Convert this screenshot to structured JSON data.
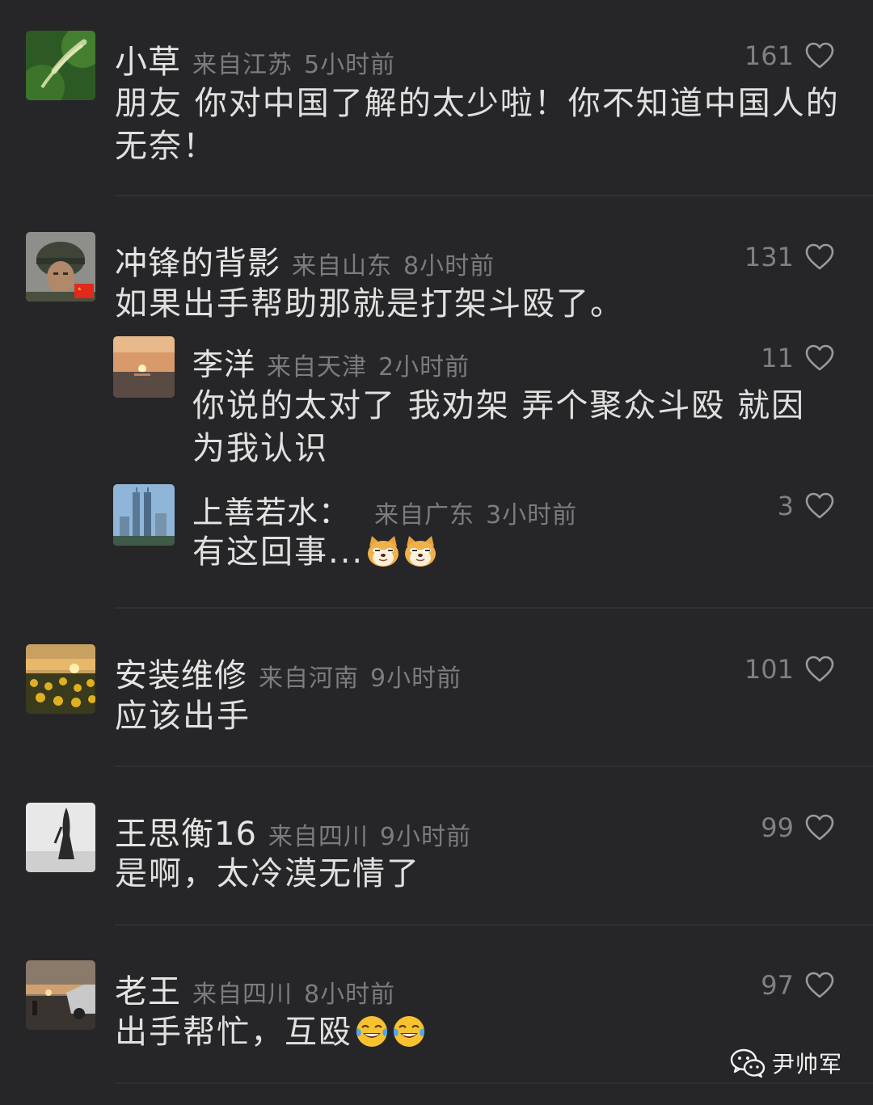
{
  "comments": [
    {
      "name": "小草",
      "location": "来自江苏",
      "time": "5小时前",
      "likes": "161",
      "text": "朋友  你对中国了解的太少啦！你不知道中国人的无奈！",
      "avatar_icon": "grass-avatar"
    },
    {
      "name": "冲锋的背影",
      "location": "来自山东",
      "time": "8小时前",
      "likes": "131",
      "text": "如果出手帮助那就是打架斗殴了。",
      "avatar_icon": "soldier-avatar",
      "replies": [
        {
          "name": "李洋",
          "location": "来自天津",
          "time": "2小时前",
          "likes": "11",
          "text": "你说的太对了 我劝架 弄个聚众斗殴 就因为我认识",
          "avatar_icon": "sunset-sea-avatar"
        },
        {
          "name": "上善若水：",
          "location": "来自广东",
          "time": "3小时前",
          "likes": "3",
          "text": "有这回事...",
          "emoji": "doge-emoji",
          "avatar_icon": "city-towers-avatar"
        }
      ]
    },
    {
      "name": "安装维修",
      "location": "来自河南",
      "time": "9小时前",
      "likes": "101",
      "text": "应该出手",
      "avatar_icon": "sunflower-field-avatar"
    },
    {
      "name": "王思衡16",
      "location": "来自四川",
      "time": "9小时前",
      "likes": "99",
      "text": "是啊，太冷漠无情了",
      "avatar_icon": "woman-silhouette-avatar"
    },
    {
      "name": "老王",
      "location": "来自四川",
      "time": "8小时前",
      "likes": "97",
      "text": "出手帮忙，互殴",
      "emoji": "laugh-cry-emoji",
      "avatar_icon": "car-sunset-avatar"
    }
  ],
  "watermark": {
    "text": "尹帅军",
    "icon": "wechat-icon"
  },
  "colors": {
    "background": "#262628",
    "muted": "#7c7c7e",
    "text": "#e0e0e0"
  }
}
